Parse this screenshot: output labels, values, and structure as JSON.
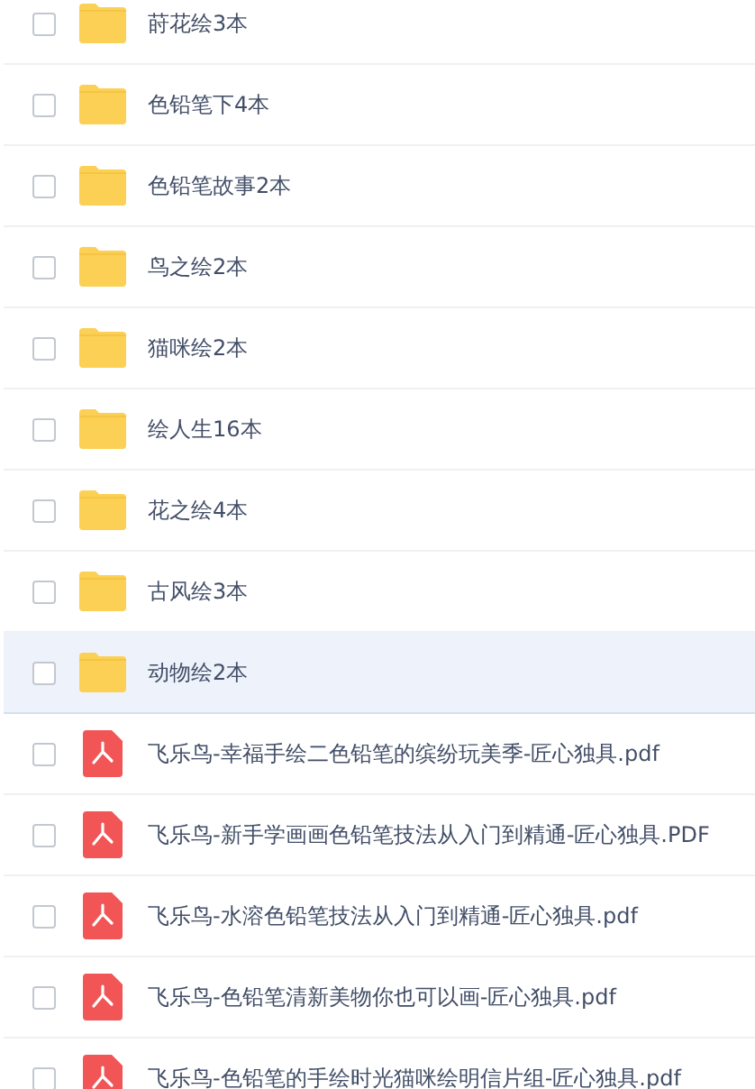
{
  "files": [
    {
      "kind": "folder",
      "name": "莳花绘3本",
      "checked": false,
      "selected": false
    },
    {
      "kind": "folder",
      "name": "色铅笔下4本",
      "checked": false,
      "selected": false
    },
    {
      "kind": "folder",
      "name": "色铅笔故事2本",
      "checked": false,
      "selected": false
    },
    {
      "kind": "folder",
      "name": "鸟之绘2本",
      "checked": false,
      "selected": false
    },
    {
      "kind": "folder",
      "name": "猫咪绘2本",
      "checked": false,
      "selected": false
    },
    {
      "kind": "folder",
      "name": "绘人生16本",
      "checked": false,
      "selected": false
    },
    {
      "kind": "folder",
      "name": "花之绘4本",
      "checked": false,
      "selected": false
    },
    {
      "kind": "folder",
      "name": "古风绘3本",
      "checked": false,
      "selected": false
    },
    {
      "kind": "folder",
      "name": "动物绘2本",
      "checked": false,
      "selected": true
    },
    {
      "kind": "pdf",
      "name": "飞乐鸟-幸福手绘二色铅笔的缤纷玩美季-匠心独具.pdf",
      "checked": false,
      "selected": false
    },
    {
      "kind": "pdf",
      "name": "飞乐鸟-新手学画画色铅笔技法从入门到精通-匠心独具.PDF",
      "checked": false,
      "selected": false
    },
    {
      "kind": "pdf",
      "name": "飞乐鸟-水溶色铅笔技法从入门到精通-匠心独具.pdf",
      "checked": false,
      "selected": false
    },
    {
      "kind": "pdf",
      "name": "飞乐鸟-色铅笔清新美物你也可以画-匠心独具.pdf",
      "checked": false,
      "selected": false
    },
    {
      "kind": "pdf",
      "name": "飞乐鸟-色铅笔的手绘时光猫咪绘明信片组-匠心独具.pdf",
      "checked": false,
      "selected": false
    }
  ]
}
